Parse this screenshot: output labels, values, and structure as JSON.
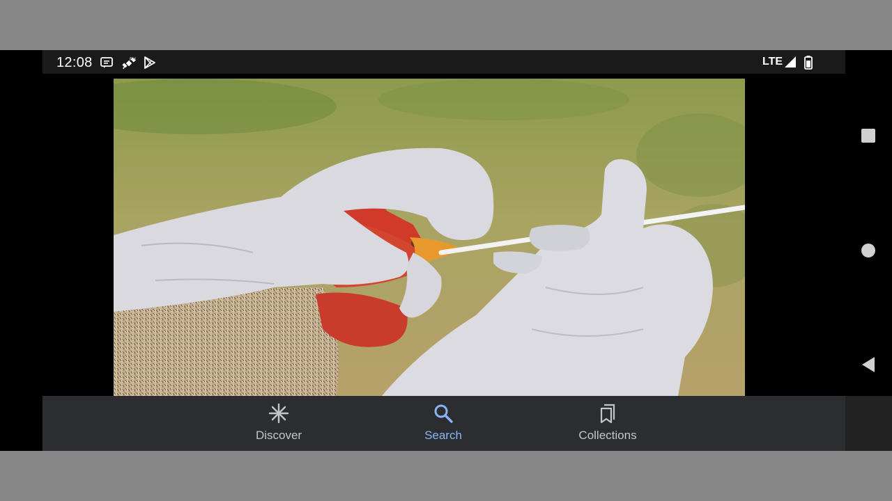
{
  "status_bar": {
    "time": "12:08",
    "icons": [
      "message-icon",
      "satellite-icon",
      "play-store-icon"
    ],
    "network": "LTE",
    "signal_icon": "signal-icon",
    "battery_icon": "battery-icon"
  },
  "image": {
    "subject": "gloved-hands-swabbing-chicken-beak-photo"
  },
  "system_nav": [
    "recents-button",
    "home-button",
    "back-button"
  ],
  "bottom_nav": {
    "tabs": [
      {
        "label": "Discover",
        "icon": "asterisk-icon",
        "active": false
      },
      {
        "label": "Search",
        "icon": "search-icon",
        "active": true
      },
      {
        "label": "Collections",
        "icon": "bookmarks-icon",
        "active": false
      }
    ],
    "active_color": "#8ab4f8",
    "inactive_color": "#c4c7c5"
  }
}
